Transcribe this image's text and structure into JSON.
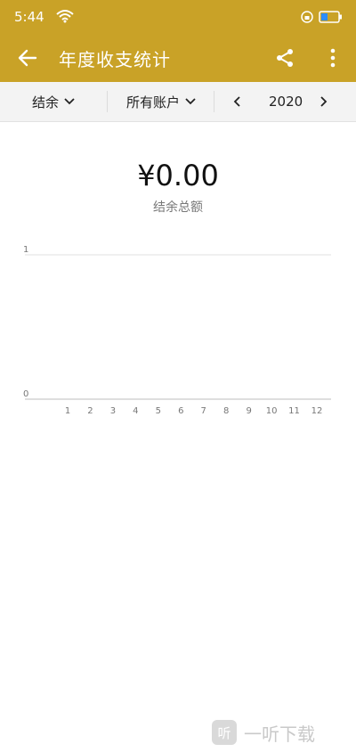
{
  "status_bar": {
    "time": "5:44",
    "wifi_icon": "wifi-icon",
    "lock_icon": "lock-rotation-icon",
    "battery_icon": "battery-icon",
    "battery_color": "#2c8dff"
  },
  "app_bar": {
    "title": "年度收支统计",
    "back_icon": "arrow-left-icon",
    "share_icon": "share-icon",
    "more_icon": "more-vertical-icon",
    "color": "#c9a227"
  },
  "filters": {
    "type": "结余",
    "account": "所有账户",
    "year": "2020"
  },
  "summary": {
    "amount": "¥0.00",
    "label": "结余总额"
  },
  "chart_data": {
    "type": "line",
    "x": [
      1,
      2,
      3,
      4,
      5,
      6,
      7,
      8,
      9,
      10,
      11,
      12
    ],
    "x_tick_labels": [
      "1",
      "2",
      "3",
      "4",
      "5",
      "6",
      "7",
      "8",
      "9",
      "10",
      "11",
      "12"
    ],
    "y_tick_labels": [
      "1",
      "0"
    ],
    "ylim": [
      0,
      1
    ],
    "series": [
      {
        "values": [
          0,
          0,
          0,
          0,
          0,
          0,
          0,
          0,
          0,
          0,
          0,
          0
        ]
      }
    ],
    "grid": true
  },
  "watermark": {
    "logo_text": "听",
    "text": "一听下载"
  }
}
